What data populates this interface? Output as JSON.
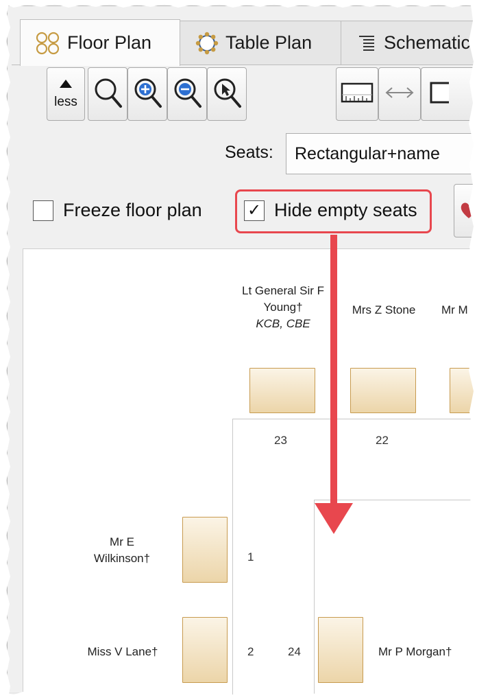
{
  "tabs": [
    {
      "label": "Floor Plan",
      "icon": "floor-plan-icon",
      "active": true
    },
    {
      "label": "Table Plan",
      "icon": "table-plan-icon",
      "active": false
    },
    {
      "label": "Schematic",
      "icon": "schematic-icon",
      "active": false
    }
  ],
  "toolbar": {
    "less_label": "less",
    "buttons": [
      "zoom-icon",
      "zoom-in-icon",
      "zoom-out-icon",
      "zoom-select-icon",
      "ruler-icon",
      "fit-width-icon"
    ]
  },
  "seats": {
    "label": "Seats:",
    "value": "Rectangular+name"
  },
  "checkboxes": {
    "freeze_label": "Freeze floor plan",
    "freeze_checked": false,
    "hide_label": "Hide empty seats",
    "hide_checked": true,
    "check_mark": "✓"
  },
  "colors": {
    "highlight": "#e8474e",
    "seat_border": "#c79a4e",
    "seat_fill": "#ecd5a9"
  },
  "floorplan": {
    "guests_top": [
      {
        "name1": "Lt General Sir F",
        "name2": "Young†",
        "title": "KCB, CBE",
        "seat": "23"
      },
      {
        "name1": "Mrs Z Stone",
        "seat": "22"
      },
      {
        "name1": "Mr M"
      }
    ],
    "guests_left": [
      {
        "name1": "Mr E",
        "name2": "Wilkinson†",
        "seat": "1"
      },
      {
        "name1": "Miss V Lane†",
        "seat": "2"
      }
    ],
    "guests_inner": [
      {
        "name1": "Mr P Morgan†",
        "seat": "24"
      }
    ]
  }
}
